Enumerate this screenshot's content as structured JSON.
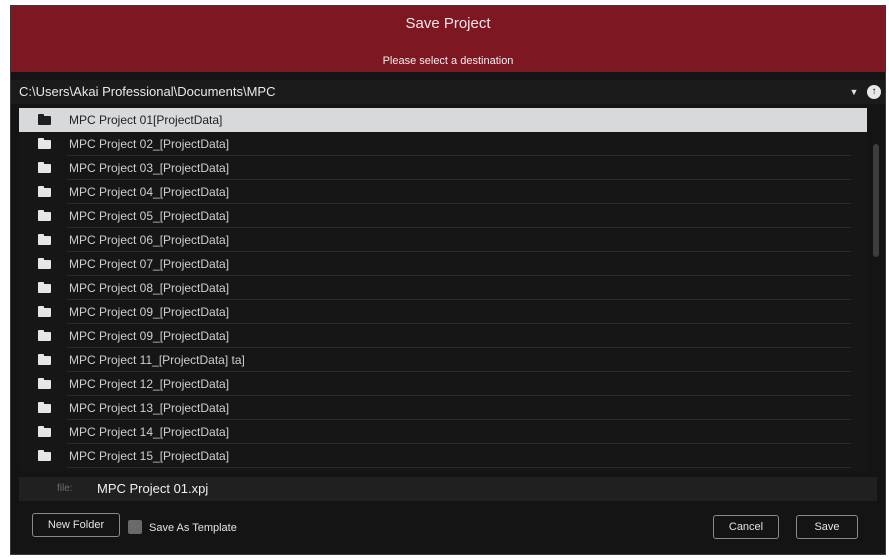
{
  "dialog": {
    "title": "Save Project",
    "subtitle": "Please select a destination"
  },
  "path": {
    "value": "C:\\Users\\Akai Professional\\Documents\\MPC",
    "dropdown_icon": "caret-down-icon",
    "up_icon": "up-arrow-icon"
  },
  "files": [
    {
      "name": "MPC Project 01[ProjectData]",
      "selected": true
    },
    {
      "name": "MPC Project 02_[ProjectData]"
    },
    {
      "name": "MPC Project 03_[ProjectData]"
    },
    {
      "name": "MPC Project 04_[ProjectData]"
    },
    {
      "name": "MPC Project 05_[ProjectData]"
    },
    {
      "name": "MPC Project 06_[ProjectData]"
    },
    {
      "name": "MPC Project 07_[ProjectData]"
    },
    {
      "name": "MPC Project 08_[ProjectData]"
    },
    {
      "name": "MPC Project 09_[ProjectData]"
    },
    {
      "name": "MPC Project 09_[ProjectData]"
    },
    {
      "name": "MPC Project 11_[ProjectData] ta]"
    },
    {
      "name": "MPC Project 12_[ProjectData]"
    },
    {
      "name": "MPC Project 13_[ProjectData]"
    },
    {
      "name": "MPC Project 14_[ProjectData]"
    },
    {
      "name": "MPC Project 15_[ProjectData]"
    }
  ],
  "file_field": {
    "label": "file:",
    "value": "MPC Project 01.xpj"
  },
  "footer": {
    "new_folder": "New Folder",
    "save_as_template": "Save As Template",
    "save_as_template_checked": false,
    "cancel": "Cancel",
    "save": "Save"
  },
  "colors": {
    "title_bar": "#7d1722",
    "background": "#141414",
    "selected_row": "#d7dadd"
  }
}
